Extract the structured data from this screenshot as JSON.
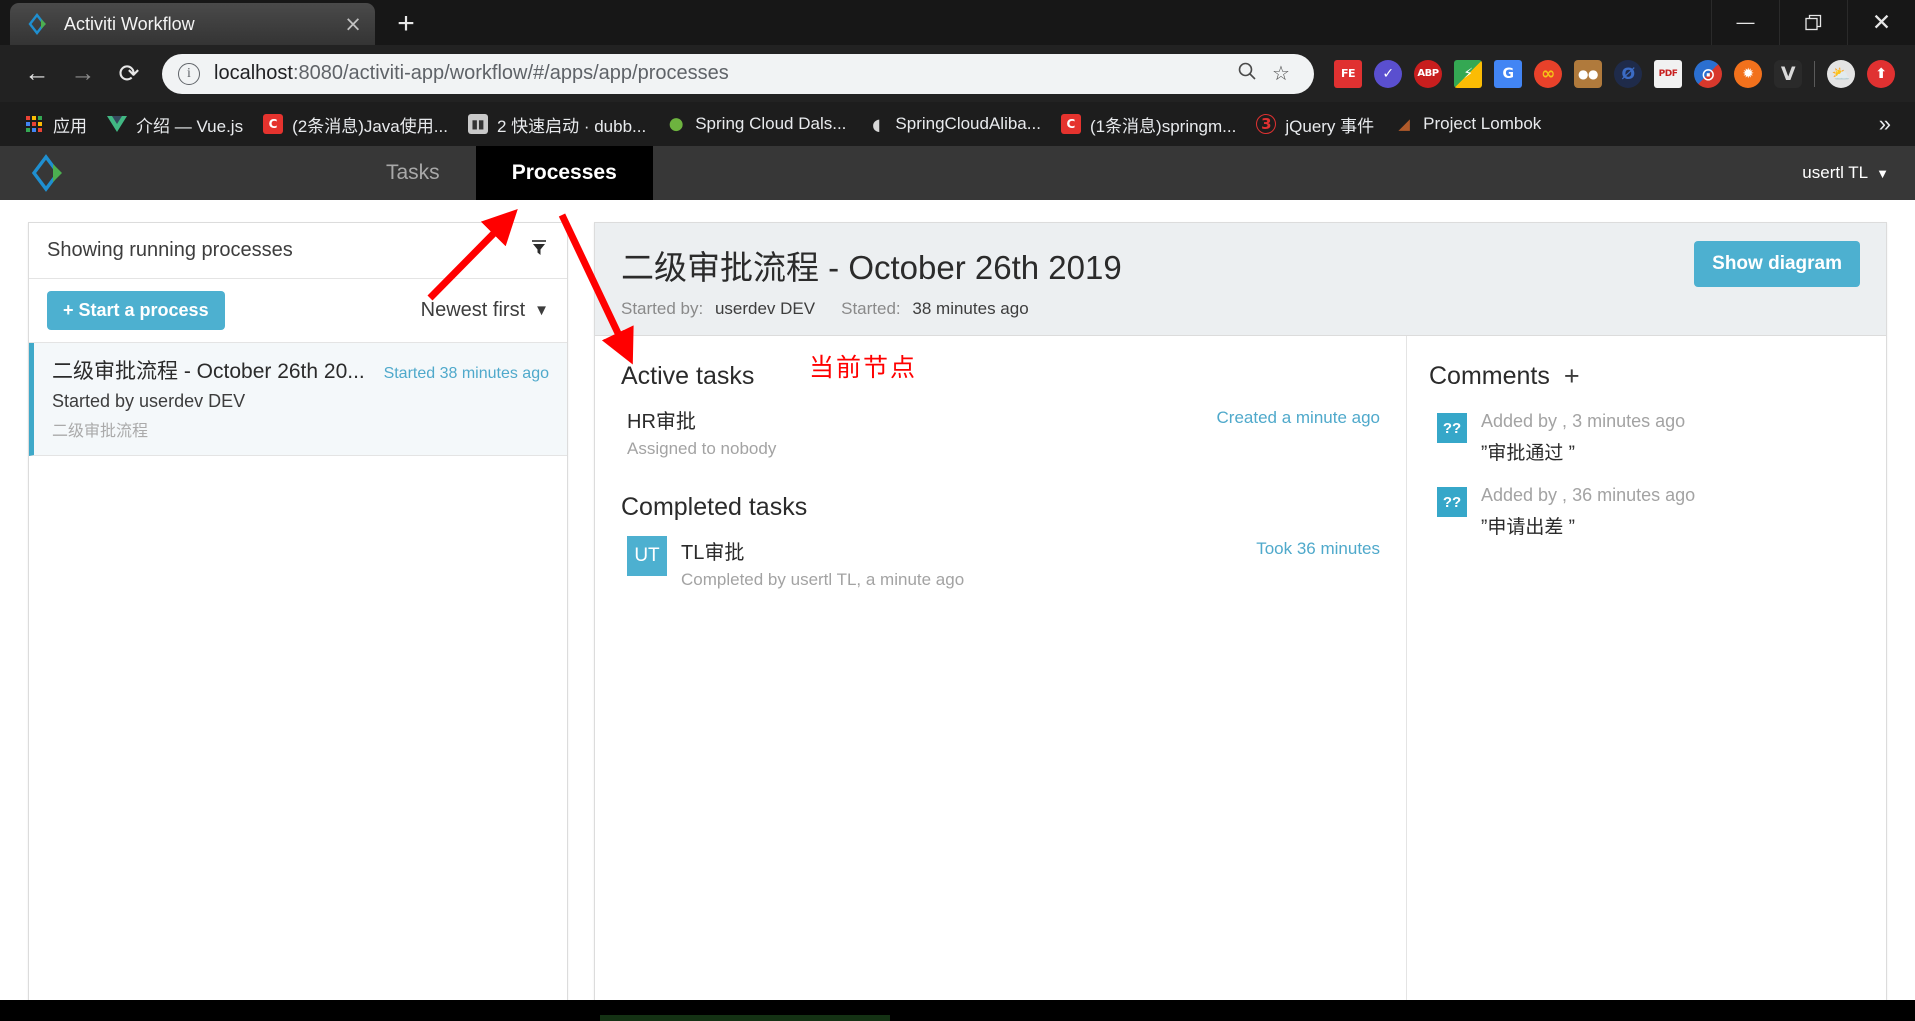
{
  "browser": {
    "tab": {
      "title": "Activiti Workflow",
      "favicon": "activiti-diamond-icon",
      "close": "×"
    },
    "newtab_label": "+",
    "window_controls": {
      "minimize": "—",
      "maximize": "❐",
      "close": "✕"
    },
    "nav": {
      "back": "←",
      "forward": "→",
      "reload": "⟳"
    },
    "omnibox": {
      "info_icon": "ⓘ",
      "url_host": "localhost",
      "url_rest": ":8080/activiti-app/workflow/#/apps/app/processes",
      "zoom_icon": "⚲",
      "star_icon": "☆"
    },
    "extensions": [
      {
        "name": "fe-extension-icon",
        "label": "FE",
        "color": "#e03131",
        "color2": "#1d6fd0"
      },
      {
        "name": "check-circle-extension-icon",
        "label": "✔",
        "color": "#5a4fcf",
        "color2": "#ffffff"
      },
      {
        "name": "adblock-plus-extension-icon",
        "label": "ABP",
        "color": "#c81e1e",
        "color2": "#ffffff"
      },
      {
        "name": "colorzilla-extension-icon",
        "label": "⚡",
        "color": "#34a853",
        "color2": "#fbbc04"
      },
      {
        "name": "google-translate-extension-icon",
        "label": "G",
        "color": "#4285f4",
        "color2": "#ffffff"
      },
      {
        "name": "infinity-extension-icon",
        "label": "∞",
        "color": "#e8412a",
        "color2": "#f5c518"
      },
      {
        "name": "tampermonkey-extension-icon",
        "label": "●●",
        "color": "#b07a3c",
        "color2": "#ffffff"
      },
      {
        "name": "evernote-extension-icon",
        "label": "Ø",
        "color": "#1f2b4a",
        "color2": "#3b6bc4"
      },
      {
        "name": "pdfjs-extension-icon",
        "label": "PDF",
        "color": "#f1f1f1",
        "color2": "#c81e1e"
      },
      {
        "name": "proxy-switch-extension-icon",
        "label": "⬚",
        "color": "#2b6fd0",
        "color2": "#d8382c"
      },
      {
        "name": "octotree-extension-icon",
        "label": "✹",
        "color": "#f2711c",
        "color2": "#ffffff"
      },
      {
        "name": "vimium-extension-icon",
        "label": "V",
        "color": "#4b4b4b",
        "color2": "#d9d9d9"
      }
    ],
    "actions": [
      {
        "name": "weather-extension-icon",
        "label": "⛅",
        "color": "#e8e8e8",
        "color2": "#ffcc33"
      },
      {
        "name": "profile-update-icon",
        "label": "⬆",
        "color": "#e03131",
        "color2": "#ffffff"
      }
    ],
    "bookmarks": [
      {
        "label": "应用",
        "icon": "apps-grid-icon",
        "color": "#eb5757"
      },
      {
        "label": "介绍 — Vue.js",
        "icon": "vuejs-icon",
        "color": "#41b883"
      },
      {
        "label": "(2条消息)Java使用...",
        "icon": "csdn-icon",
        "color": "#e5332e"
      },
      {
        "label": "2 快速启动 · dubb...",
        "icon": "dubbo-icon",
        "color": "#9aa0a6"
      },
      {
        "label": "Spring Cloud Dals...",
        "icon": "spring-icon",
        "color": "#6db33f"
      },
      {
        "label": "SpringCloudAliba...",
        "icon": "alibaba-icon",
        "color": "#cfcfcf"
      },
      {
        "label": "(1条消息)springm...",
        "icon": "csdn-icon",
        "color": "#e5332e"
      },
      {
        "label": "jQuery 事件",
        "icon": "runoob-icon",
        "color": "#e03131"
      },
      {
        "label": "Project Lombok",
        "icon": "lombok-icon",
        "color": "#b05a2a"
      }
    ],
    "bookmarks_overflow": "»"
  },
  "app": {
    "logo": "activiti-diamond-logo",
    "tabs": [
      {
        "label": "Tasks",
        "active": false
      },
      {
        "label": "Processes",
        "active": true
      }
    ],
    "user": {
      "name": "usertl TL",
      "caret": "⌄"
    }
  },
  "list_panel": {
    "header": "Showing running processes",
    "filter_icon": "funnel-filter-icon",
    "start_button": "+ Start a process",
    "sort": {
      "value": "Newest first",
      "chevron": "⌄"
    },
    "processes": [
      {
        "title": "二级审批流程 - October 26th 20...",
        "when": "Started 38 minutes ago",
        "started_by": "Started by userdev DEV",
        "definition": "二级审批流程"
      }
    ]
  },
  "detail": {
    "title": "二级审批流程 - October 26th 2019",
    "started_by_label": "Started by:",
    "started_by_value": "userdev DEV",
    "started_label": "Started:",
    "started_value": "38 minutes ago",
    "show_diagram_button": "Show diagram",
    "annotation": "当前节点",
    "active_tasks_title": "Active tasks",
    "active_tasks": [
      {
        "name": "HR审批",
        "sub": "Assigned to nobody",
        "meta": "Created a minute ago",
        "avatar": ""
      }
    ],
    "completed_tasks_title": "Completed tasks",
    "completed_tasks": [
      {
        "name": "TL审批",
        "sub": "Completed by usertl TL, a minute ago",
        "meta": "Took 36 minutes",
        "avatar": "UT"
      }
    ],
    "comments_title": "Comments",
    "comments_add": "+",
    "comments": [
      {
        "avatar": "??",
        "by": "Added by , 3 minutes ago",
        "text": "”审批通过 ”"
      },
      {
        "avatar": "??",
        "by": "Added by , 36 minutes ago",
        "text": "”申请出差 ”"
      }
    ]
  },
  "colors": {
    "accent_teal": "#4db0d0",
    "link_blue": "#4fa9cb",
    "annotation_red": "#ff0000",
    "active_tab_bg": "#000000",
    "appbar_bg": "#373737"
  }
}
